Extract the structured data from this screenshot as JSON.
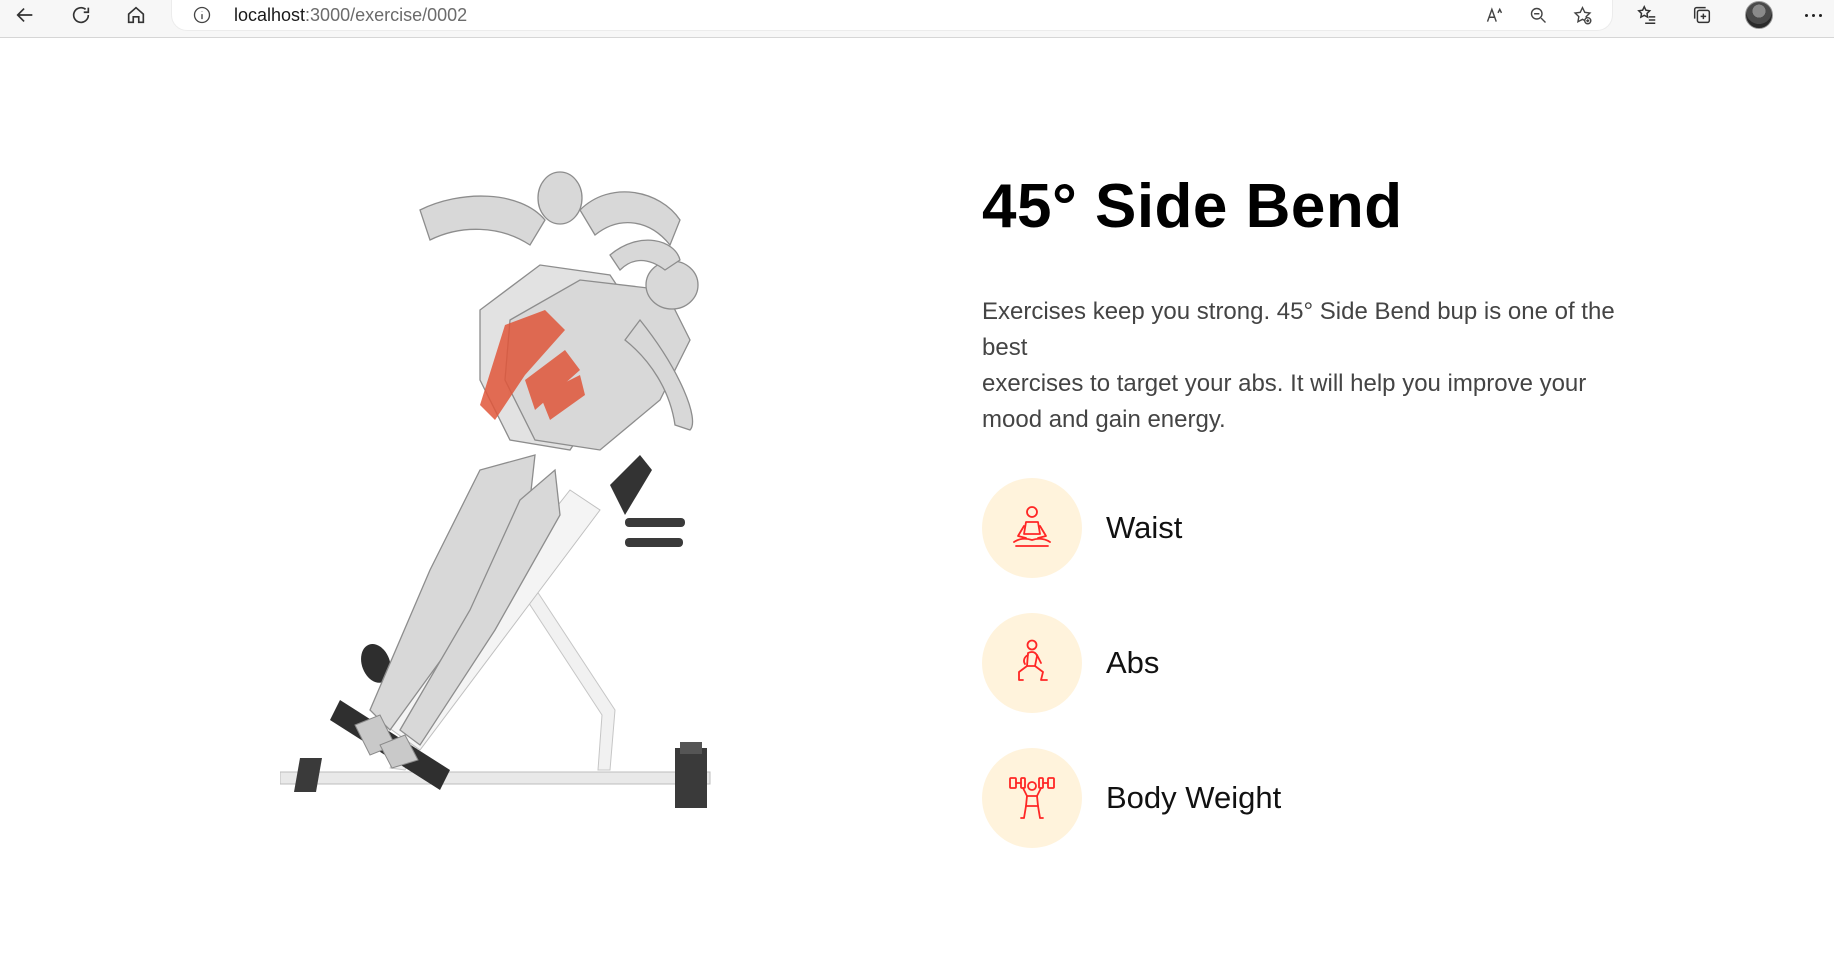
{
  "browser": {
    "url_host": "localhost",
    "url_path": ":3000/exercise/0002"
  },
  "exercise": {
    "title": "45° Side Bend",
    "description_lines": [
      "Exercises keep you strong. 45° Side Bend bup is one of the best",
      "exercises to target your abs. It will help you improve your mood and gain energy."
    ],
    "tags": [
      {
        "label": "Waist",
        "icon": "meditation-icon"
      },
      {
        "label": "Abs",
        "icon": "lunge-icon"
      },
      {
        "label": "Body Weight",
        "icon": "dumbbell-lift-icon"
      }
    ]
  },
  "colors": {
    "accent": "#ff2625",
    "tag_bg": "#fff3dc",
    "muscle_highlight": "#e0563a"
  }
}
